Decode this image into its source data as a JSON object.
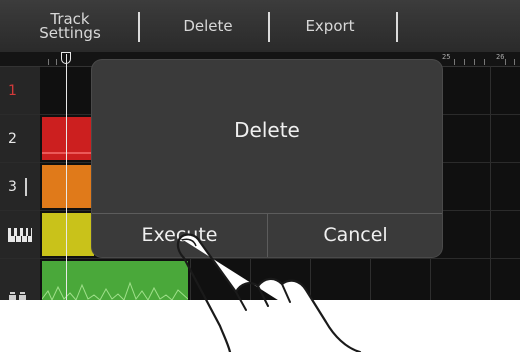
{
  "menu": {
    "items": [
      {
        "label_line1": "Track",
        "label_line2": "Settings"
      },
      {
        "label": "Delete"
      },
      {
        "label": "Export"
      }
    ]
  },
  "ruler": {
    "numbers": [
      "25",
      "26"
    ]
  },
  "tracks": [
    {
      "label": "1",
      "color": "#101010"
    },
    {
      "label": "2",
      "color": "#cc1f1f"
    },
    {
      "label": "3",
      "color": "#e07a1a"
    },
    {
      "label": "",
      "icon": "piano-keys-icon",
      "color": "#c9c21a"
    },
    {
      "label": "",
      "icon": "drum-icon",
      "color": "#4aa83a"
    }
  ],
  "dialog": {
    "title": "Delete",
    "execute_label": "Execute",
    "cancel_label": "Cancel"
  },
  "colors": {
    "background": "#101010",
    "dialog": "#3a3a3a",
    "track2": "#cc1f1f",
    "track3": "#e07a1a",
    "track4": "#c9c21a",
    "track5": "#4aa83a"
  }
}
